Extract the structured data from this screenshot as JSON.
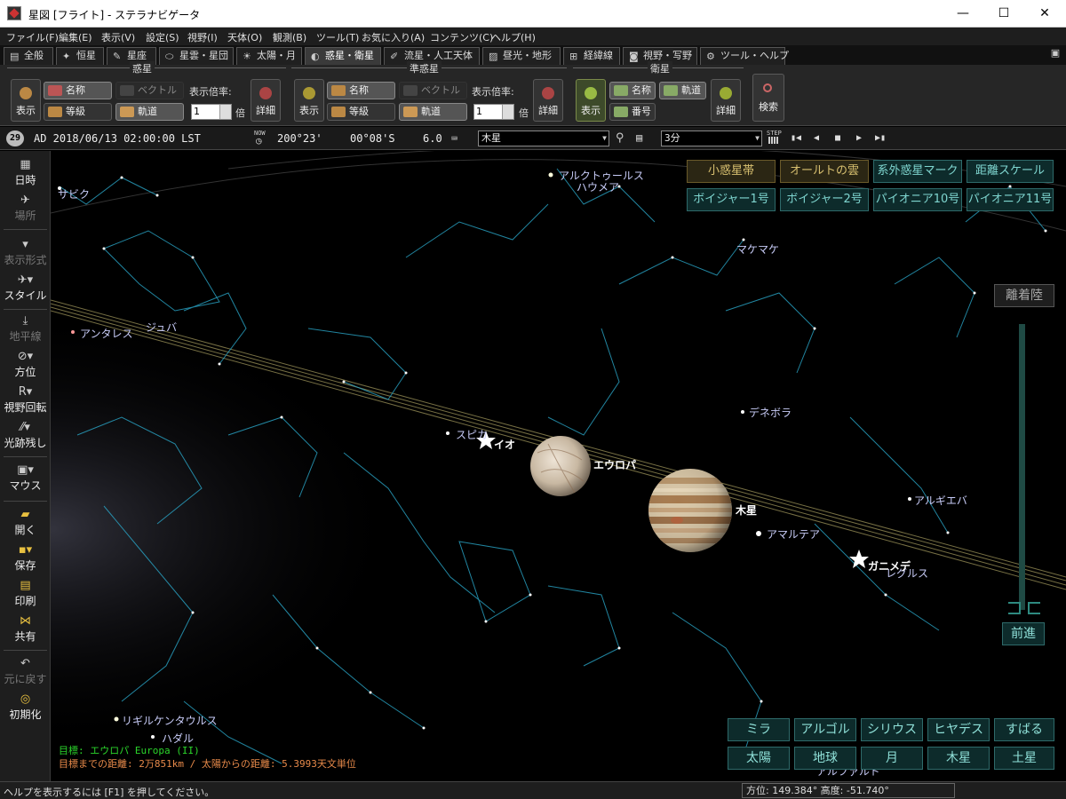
{
  "window": {
    "title": "星図 [フライト] - ステラナビゲータ",
    "minimize": "—",
    "maximize": "☐",
    "close": "✕"
  },
  "menu": [
    "ファイル(F)",
    "編集(E)",
    "表示(V)",
    "設定(S)",
    "視野(I)",
    "天体(O)",
    "観測(B)",
    "ツール(T)",
    "お気に入り(A)",
    "コンテンツ(C)",
    "ヘルプ(H)"
  ],
  "tabs": [
    "全般",
    "恒星",
    "星座",
    "星雲・星団",
    "太陽・月",
    "惑星・衛星",
    "流星・人工天体",
    "昼光・地形",
    "経緯線",
    "視野・写野",
    "ツール・ヘルプ"
  ],
  "active_tab": "惑星・衛星",
  "ribbon": {
    "planet": {
      "header": "惑星",
      "show": "表示",
      "name": "名称",
      "vector": "ベクトル",
      "magnitude": "等級",
      "orbit": "軌道",
      "scale_label": "表示倍率:",
      "scale_value": "1",
      "scale_unit": "倍",
      "detail": "詳細"
    },
    "dwarf": {
      "header": "準惑星",
      "show": "表示",
      "name": "名称",
      "vector": "ベクトル",
      "magnitude": "等級",
      "orbit": "軌道",
      "scale_label": "表示倍率:",
      "scale_value": "1",
      "scale_unit": "倍",
      "detail": "詳細"
    },
    "satellite": {
      "header": "衛星",
      "show": "表示",
      "name": "名称",
      "orbit": "軌道",
      "number": "番号",
      "detail": "詳細"
    },
    "search": "検索"
  },
  "statusline": {
    "day": "29",
    "datetime": "AD 2018/06/13 02:00:00 LST",
    "now_label": "NOW",
    "azimuth": "200°23'",
    "altitude": "00°08'S",
    "magnitude": "6.0",
    "target": "木星",
    "step": "3分",
    "step_label": "STEP"
  },
  "left_toolbar": [
    "日時",
    "場所",
    "表示形式",
    "スタイル",
    "地平線",
    "方位",
    "視野回転",
    "光跡残し",
    "マウス",
    "開く",
    "保存",
    "印刷",
    "共有",
    "元に戻す",
    "初期化"
  ],
  "overlay_buttons": [
    "小惑星帯",
    "オールトの雲",
    "系外惑星マーク",
    "距離スケール",
    "ボイジャー1号",
    "ボイジャー2号",
    "パイオニア10号",
    "パイオニア11号"
  ],
  "flight_buttons": {
    "depart": "離着陸",
    "forward": "前進"
  },
  "quick_targets": [
    "ミラ",
    "アルゴル",
    "シリウス",
    "ヒヤデス",
    "すばる",
    "太陽",
    "地球",
    "月",
    "木星",
    "土星"
  ],
  "labels": {
    "stars": [
      "サビク",
      "アルクトゥールス",
      "ハウメア",
      "マケマケ",
      "アンタレス",
      "ジュバ",
      "デネボラ",
      "スピカ",
      "アルギエバ",
      "アマルテア",
      "レグルス",
      "リギルケンタウルス",
      "ハダル",
      "アルファルド"
    ],
    "moons": [
      "イオ",
      "エウロパ",
      "ガニメデ"
    ],
    "planet": "木星"
  },
  "info": {
    "target": "目標: エウロパ Europa (II)",
    "distance": "目標までの距離: 2万851km / 太陽からの距離: 5.3993天文単位"
  },
  "bottom": {
    "help": "ヘルプを表示するには [F1] を押してください。",
    "coords": "方位: 149.384°  高度: -51.740°"
  },
  "colors": {
    "accent": "#7fd6d0",
    "info_target": "#2bd62b",
    "info_distance": "#e88a4a",
    "label": "#c8ccf8",
    "constellation": "#2aa7c9"
  }
}
